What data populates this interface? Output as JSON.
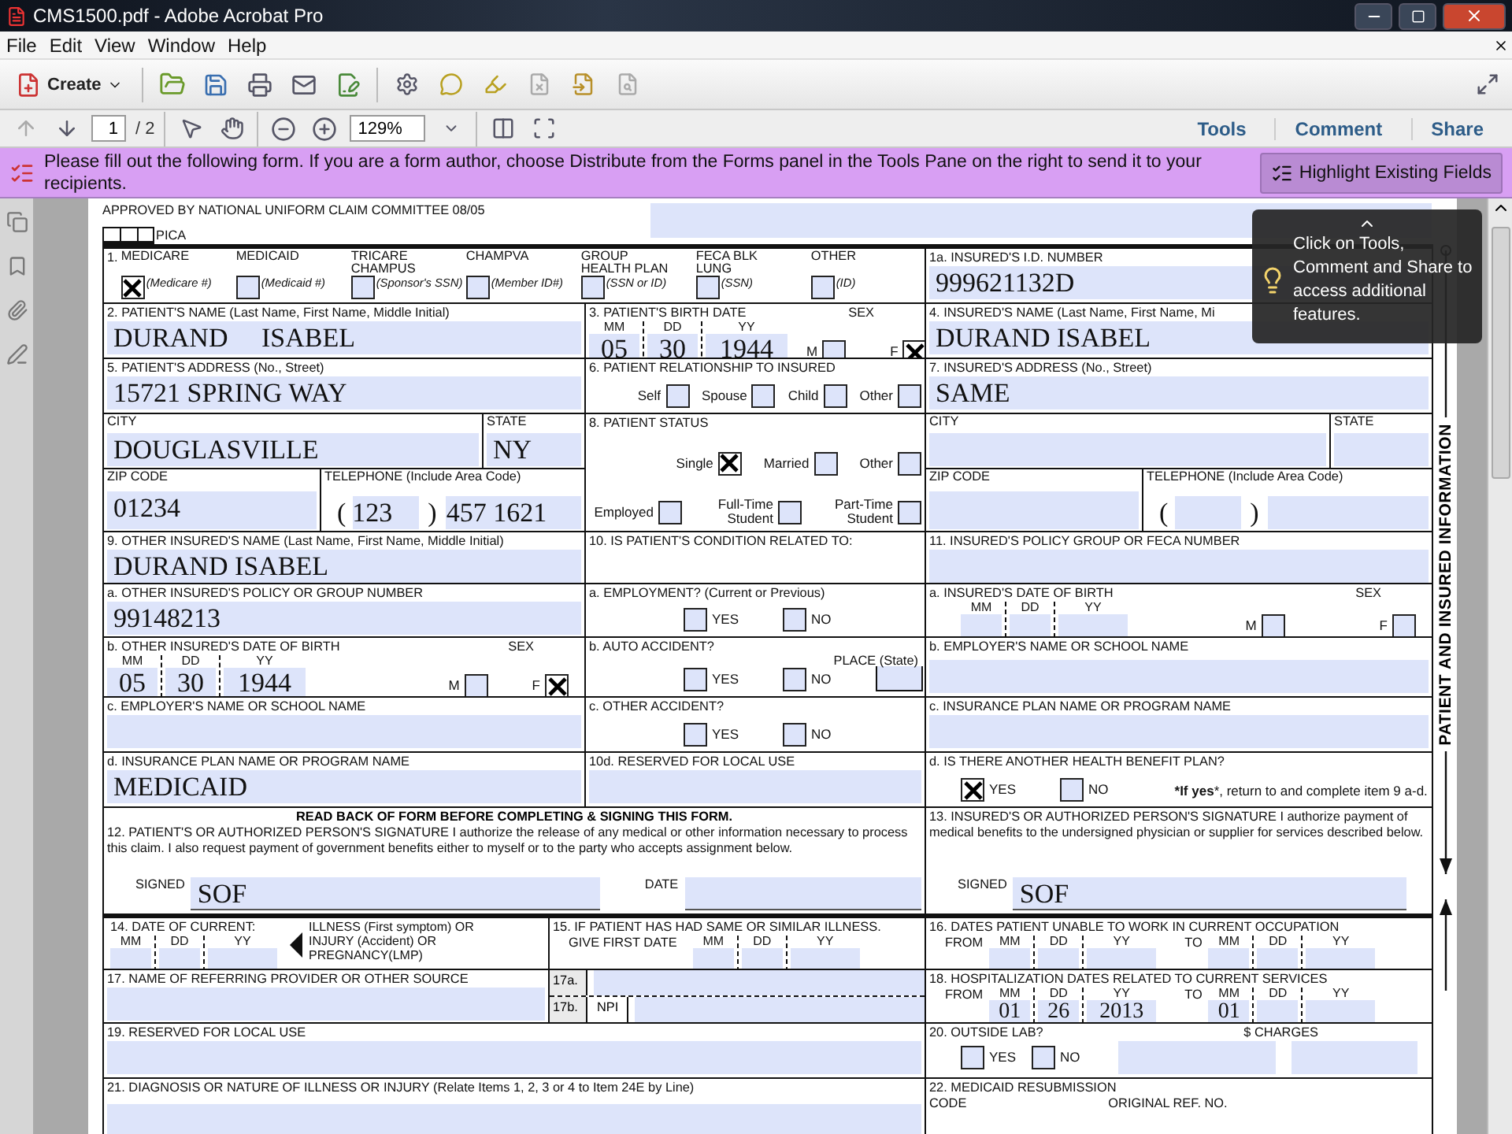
{
  "window": {
    "title": "CMS1500.pdf - Adobe Acrobat Pro"
  },
  "menu": [
    "File",
    "Edit",
    "View",
    "Window",
    "Help"
  ],
  "toolbar": {
    "create": "Create"
  },
  "nav": {
    "page": "1",
    "total": "/ 2",
    "zoom": "129%",
    "panes": [
      "Tools",
      "Comment",
      "Share"
    ]
  },
  "message": {
    "text": "Please fill out the following form. If you are a form author, choose Distribute from the Forms panel in the Tools Pane on the right to send it to your recipients.",
    "button": "Highlight Existing Fields"
  },
  "tooltip": {
    "text": "Click on Tools, Comment and Share to access additional features."
  },
  "form": {
    "approved": "APPROVED BY NATIONAL UNIFORM CLAIM COMMITTEE 08/05",
    "pica": "PICA",
    "side_label": "PATIENT AND INSURED INFORMATION",
    "item1": {
      "number": "1.",
      "types": [
        {
          "name": "MEDICARE",
          "id": "(Medicare #)",
          "checked": true
        },
        {
          "name": "MEDICAID",
          "id": "(Medicaid  #)",
          "checked": false
        },
        {
          "name": "TRICARE CHAMPUS",
          "id": "(Sponsor's SSN)",
          "checked": false
        },
        {
          "name": "CHAMPVA",
          "id": "(Member ID#)",
          "checked": false
        },
        {
          "name": "GROUP HEALTH PLAN",
          "id": "(SSN or ID)",
          "checked": false
        },
        {
          "name": "FECA BLK LUNG",
          "id": "(SSN)",
          "checked": false
        },
        {
          "name": "OTHER",
          "id": "(ID)",
          "checked": false
        }
      ]
    },
    "item1a": {
      "label": "1a. INSURED'S I.D. NUMBER",
      "value": "999621132D"
    },
    "grid": [
      {
        "kind": "text",
        "label": "2. PATIENT'S NAME (Last Name, First Name, Middle Initial)",
        "value": "DURAND     ISABEL"
      },
      {
        "kind": "date_sex",
        "label": "3. PATIENT'S BIRTH DATE",
        "heads": [
          "MM",
          "DD",
          "YY"
        ],
        "values": [
          "05",
          "30",
          "1944"
        ],
        "sex_label": "SEX",
        "sex": [
          {
            "label": "M",
            "checked": false
          },
          {
            "label": "F",
            "checked": true
          }
        ]
      },
      {
        "kind": "text",
        "label": "4. INSURED'S NAME (Last Name, First Name, Mi",
        "value": "DURAND ISABEL"
      },
      {
        "kind": "text",
        "label": "5. PATIENT'S ADDRESS (No., Street)",
        "value": "15721 SPRING WAY"
      },
      {
        "kind": "checks",
        "label": "6. PATIENT RELATIONSHIP TO INSURED",
        "options": [
          {
            "label": "Self",
            "checked": false
          },
          {
            "label": "Spouse",
            "checked": false
          },
          {
            "label": "Child",
            "checked": false
          },
          {
            "label": "Other",
            "checked": false
          }
        ]
      },
      {
        "kind": "text",
        "label": "7. INSURED'S ADDRESS (No., Street)",
        "value": "SAME"
      },
      {
        "kind": "city_state",
        "city_label": "CITY",
        "city": "DOUGLASVILLE",
        "state_label": "STATE",
        "state": "NY"
      },
      {
        "kind": "status",
        "label": "8. PATIENT STATUS",
        "groups": [
          [
            {
              "label": "Single",
              "checked": true
            },
            {
              "label": "Married",
              "checked": false
            },
            {
              "label": "Other",
              "checked": false
            }
          ],
          [
            {
              "label": "Employed",
              "checked": false
            },
            {
              "label": "Full-Time Student",
              "checked": false
            },
            {
              "label": "Part-Time Student",
              "checked": false
            }
          ]
        ]
      },
      {
        "kind": "city_state",
        "city_label": "CITY",
        "state_label": "STATE"
      },
      {
        "kind": "zip_phone",
        "zip_label": "ZIP CODE",
        "zip": "01234",
        "phone_label": "TELEPHONE (Include Area Code)",
        "open": "(",
        "area": "123",
        "close": ")",
        "number": "457 1621"
      },
      {
        "kind": "zip_phone",
        "zip_label": "ZIP CODE",
        "phone_label": "TELEPHONE (Include Area Code)",
        "open": "(",
        "close": ")"
      },
      {
        "kind": "text",
        "label": "9. OTHER INSURED'S NAME (Last Name, First Name, Middle Initial)",
        "value": "DURAND ISABEL"
      },
      {
        "kind": "header",
        "label": "10. IS PATIENT'S CONDITION RELATED TO:"
      },
      {
        "kind": "text",
        "label": "11. INSURED'S POLICY GROUP OR FECA NUMBER"
      },
      {
        "kind": "text",
        "label": "a. OTHER INSURED'S POLICY OR GROUP NUMBER",
        "value": "99148213"
      },
      {
        "kind": "yes_no",
        "label": "a. EMPLOYMENT? (Current or Previous)",
        "options": [
          {
            "label": "YES",
            "checked": false
          },
          {
            "label": "NO",
            "checked": false
          }
        ]
      },
      {
        "kind": "date_sex",
        "label": "a. INSURED'S DATE OF BIRTH",
        "heads": [
          "MM",
          "DD",
          "YY"
        ],
        "sex_label": "SEX",
        "sex": [
          {
            "label": "M",
            "checked": false
          },
          {
            "label": "F",
            "checked": false
          }
        ]
      },
      {
        "kind": "date_sex",
        "label": "b. OTHER INSURED'S DATE OF BIRTH",
        "heads": [
          "MM",
          "DD",
          "YY"
        ],
        "values": [
          "05",
          "30",
          "1944"
        ],
        "sex_label": "SEX",
        "sex": [
          {
            "label": "M",
            "checked": false
          },
          {
            "label": "F",
            "checked": true
          }
        ]
      },
      {
        "kind": "yes_no",
        "label": "b. AUTO ACCIDENT?",
        "place": "PLACE (State)",
        "options": [
          {
            "label": "YES",
            "checked": false
          },
          {
            "label": "NO",
            "checked": false
          }
        ]
      },
      {
        "kind": "text",
        "label": "b. EMPLOYER'S NAME OR SCHOOL NAME"
      },
      {
        "kind": "text",
        "label": "c. EMPLOYER'S NAME OR SCHOOL NAME"
      },
      {
        "kind": "yes_no",
        "label": "c. OTHER ACCIDENT?",
        "options": [
          {
            "label": "YES",
            "checked": false
          },
          {
            "label": "NO",
            "checked": false
          }
        ]
      },
      {
        "kind": "text",
        "label": "c. INSURANCE PLAN NAME OR PROGRAM NAME"
      },
      {
        "kind": "text",
        "label": "d. INSURANCE PLAN NAME OR PROGRAM NAME",
        "value": "MEDICAID"
      },
      {
        "kind": "text",
        "label": "10d. RESERVED FOR LOCAL USE"
      },
      {
        "kind": "yes_no",
        "label": "d. IS THERE ANOTHER HEALTH BENEFIT PLAN?",
        "note": "***If yes***, return to and complete item 9 a-d.",
        "options": [
          {
            "label": "YES",
            "checked": true
          },
          {
            "label": "NO",
            "checked": false
          }
        ]
      }
    ],
    "signatures": [
      {
        "heading": "READ BACK OF FORM BEFORE COMPLETING & SIGNING THIS FORM.",
        "text": "12. PATIENT'S OR AUTHORIZED PERSON'S SIGNATURE  I authorize the release of any medical or other information necessary to process this claim. I also request payment of government benefits either to myself or to the party who accepts assignment below.",
        "signed_label": "SIGNED",
        "signed": "SOF",
        "date_label": "DATE"
      },
      {
        "text": "13. INSURED'S OR AUTHORIZED PERSON'S SIGNATURE I authorize payment of medical benefits to the undersigned physician or supplier for services described below.",
        "signed_label": "SIGNED",
        "signed": "SOF"
      }
    ],
    "lower_rows": [
      [
        {
          "kind": "date14",
          "label": "14. DATE OF CURRENT:",
          "heads": [
            "MM",
            "DD",
            "YY"
          ],
          "note": "ILLNESS (First symptom) OR INJURY (Accident) OR PREGNANCY(LMP)"
        },
        {
          "kind": "date15",
          "label": "15. IF PATIENT HAS HAD SAME OR SIMILAR ILLNESS.",
          "sub": "GIVE FIRST DATE",
          "heads": [
            "MM",
            "DD",
            "YY"
          ]
        },
        {
          "kind": "range",
          "label": "16. DATES PATIENT UNABLE TO WORK IN CURRENT OCCUPATION",
          "from_label": "FROM",
          "from_heads": [
            "MM",
            "DD",
            "YY"
          ],
          "to_label": "TO",
          "to_heads": [
            "MM",
            "DD",
            "YY"
          ]
        }
      ],
      [
        {
          "kind": "text",
          "label": "17. NAME OF REFERRING PROVIDER OR OTHER SOURCE"
        },
        {
          "kind": "ref",
          "a": "17a.",
          "b": "17b.",
          "npi": "NPI"
        },
        {
          "kind": "range",
          "label": "18. HOSPITALIZATION DATES RELATED TO CURRENT SERVICES",
          "from_label": "FROM",
          "from_heads": [
            "MM",
            "DD",
            "YY"
          ],
          "from_values": [
            "01",
            "26",
            "2013"
          ],
          "to_label": "TO",
          "to_heads": [
            "MM",
            "DD",
            "YY"
          ],
          "to_values": [
            "01"
          ]
        }
      ],
      [
        {
          "kind": "text",
          "label": "19. RESERVED FOR LOCAL USE"
        },
        {
          "kind": "lab",
          "label": "20. OUTSIDE LAB?",
          "charges": "$ CHARGES",
          "options": [
            {
              "label": "YES",
              "checked": false
            },
            {
              "label": "NO",
              "checked": false
            }
          ]
        }
      ],
      [
        {
          "kind": "text",
          "label": "21. DIAGNOSIS OR NATURE OF ILLNESS OR INJURY (Relate Items 1, 2, 3 or 4 to Item 24E by Line)"
        },
        {
          "kind": "resub",
          "label": "22. MEDICAID RESUBMISSION",
          "sub": "CODE",
          "orig": "ORIGINAL REF. NO."
        }
      ]
    ]
  }
}
